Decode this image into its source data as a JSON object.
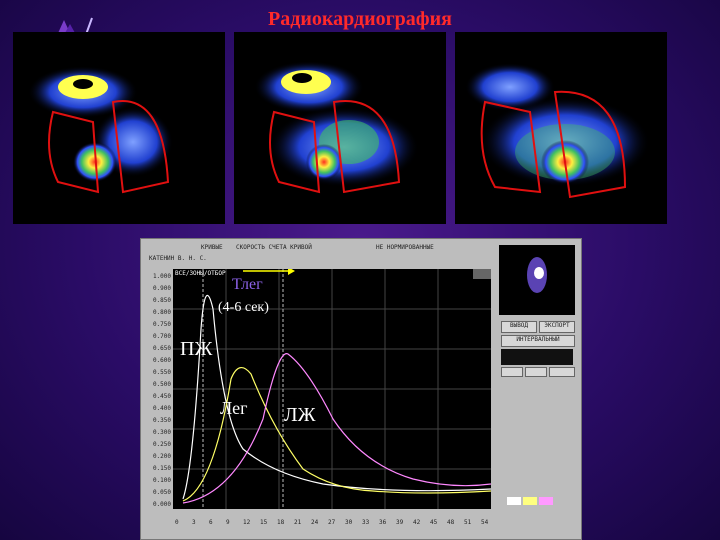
{
  "title": "Радиокардиография",
  "panel": {
    "toolbar_labels": [
      "КРИВЫЕ",
      "СКОРОСТЬ СЧЕТА КРИВОЙ",
      "НЕ НОРМИРОВАННЫЕ"
    ],
    "patient": "КАТЕНИН В. Н. С.",
    "legend_box": "ВСЕ/ЗОНЫ/ОТБОР",
    "y_ticks": [
      "1.000",
      "0.900",
      "0.850",
      "0.800",
      "0.750",
      "0.700",
      "0.650",
      "0.600",
      "0.550",
      "0.500",
      "0.450",
      "0.400",
      "0.350",
      "0.300",
      "0.250",
      "0.200",
      "0.150",
      "0.100",
      "0.050",
      "0.000"
    ],
    "x_ticks": [
      "0",
      "3",
      "6",
      "9",
      "12",
      "15",
      "18",
      "21",
      "24",
      "27",
      "30",
      "33",
      "36",
      "39",
      "42",
      "45",
      "48",
      "51",
      "54"
    ],
    "right_buttons": [
      "ВЫВОД",
      "ЭКСПОРТ",
      "ИНТЕРВАЛЬНЫЙ"
    ]
  },
  "annotations": {
    "time": "Тлег",
    "time_range": "(4-6 сек)",
    "rv": "ПЖ",
    "lung": "Лег",
    "lv": "ЛЖ"
  },
  "colors": {
    "title": "#ff2a2a",
    "rv_curve": "#ffffff",
    "lung_curve": "#ffff66",
    "lv_curve": "#ff88ff",
    "arrow": "#ffff00"
  }
}
